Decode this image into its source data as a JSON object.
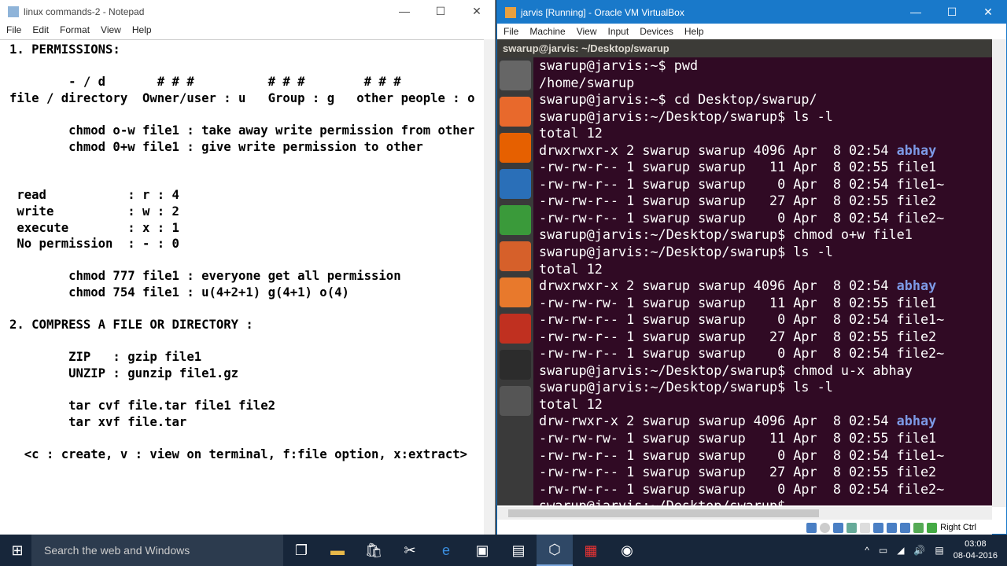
{
  "notepad": {
    "title": "linux commands-2 - Notepad",
    "menu": [
      "File",
      "Edit",
      "Format",
      "View",
      "Help"
    ],
    "lines": [
      "1. PERMISSIONS:",
      "",
      "        - / d       # # #          # # #        # # #",
      "file / directory  Owner/user : u   Group : g   other people : o",
      "",
      "        chmod o-w file1 : take away write permission from other",
      "        chmod 0+w file1 : give write permission to other",
      "",
      "",
      " read           : r : 4",
      " write          : w : 2",
      " execute        : x : 1",
      " No permission  : - : 0",
      "",
      "        chmod 777 file1 : everyone get all permission",
      "        chmod 754 file1 : u(4+2+1) g(4+1) o(4)",
      "",
      "2. COMPRESS A FILE OR DIRECTORY :",
      "",
      "        ZIP   : gzip file1",
      "        UNZIP : gunzip file1.gz",
      "",
      "        tar cvf file.tar file1 file2",
      "        tar xvf file.tar",
      "",
      "  <c : create, v : view on terminal, f:file option, x:extract>"
    ]
  },
  "virtualbox": {
    "title": "jarvis [Running] - Oracle VM VirtualBox",
    "menu": [
      "File",
      "Machine",
      "View",
      "Input",
      "Devices",
      "Help"
    ],
    "terminal_title": "swarup@jarvis: ~/Desktop/swarup",
    "host_key": "Right Ctrl",
    "lines": [
      {
        "text": "swarup@jarvis:~$ pwd"
      },
      {
        "text": "/home/swarup"
      },
      {
        "text": "swarup@jarvis:~$ cd Desktop/swarup/"
      },
      {
        "text": "swarup@jarvis:~/Desktop/swarup$ ls -l"
      },
      {
        "text": "total 12"
      },
      {
        "text": "drwxrwxr-x 2 swarup swarup 4096 Apr  8 02:54 ",
        "dir": "abhay"
      },
      {
        "text": "-rw-rw-r-- 1 swarup swarup   11 Apr  8 02:55 file1"
      },
      {
        "text": "-rw-rw-r-- 1 swarup swarup    0 Apr  8 02:54 file1~"
      },
      {
        "text": "-rw-rw-r-- 1 swarup swarup   27 Apr  8 02:55 file2"
      },
      {
        "text": "-rw-rw-r-- 1 swarup swarup    0 Apr  8 02:54 file2~"
      },
      {
        "text": "swarup@jarvis:~/Desktop/swarup$ chmod o+w file1"
      },
      {
        "text": "swarup@jarvis:~/Desktop/swarup$ ls -l"
      },
      {
        "text": "total 12"
      },
      {
        "text": "drwxrwxr-x 2 swarup swarup 4096 Apr  8 02:54 ",
        "dir": "abhay"
      },
      {
        "text": "-rw-rw-rw- 1 swarup swarup   11 Apr  8 02:55 file1"
      },
      {
        "text": "-rw-rw-r-- 1 swarup swarup    0 Apr  8 02:54 file1~"
      },
      {
        "text": "-rw-rw-r-- 1 swarup swarup   27 Apr  8 02:55 file2"
      },
      {
        "text": "-rw-rw-r-- 1 swarup swarup    0 Apr  8 02:54 file2~"
      },
      {
        "text": "swarup@jarvis:~/Desktop/swarup$ chmod u-x abhay"
      },
      {
        "text": "swarup@jarvis:~/Desktop/swarup$ ls -l"
      },
      {
        "text": "total 12"
      },
      {
        "text": "drw-rwxr-x 2 swarup swarup 4096 Apr  8 02:54 ",
        "dir": "abhay"
      },
      {
        "text": "-rw-rw-rw- 1 swarup swarup   11 Apr  8 02:55 file1"
      },
      {
        "text": "-rw-rw-r-- 1 swarup swarup    0 Apr  8 02:54 file1~"
      },
      {
        "text": "-rw-rw-r-- 1 swarup swarup   27 Apr  8 02:55 file2"
      },
      {
        "text": "-rw-rw-r-- 1 swarup swarup    0 Apr  8 02:54 file2~"
      },
      {
        "text": "swarup@jarvis:~/Desktop/swarup$ "
      }
    ],
    "launcher_icons": [
      "ubuntu-dash-icon",
      "files-icon",
      "firefox-icon",
      "writer-icon",
      "calc-icon",
      "impress-icon",
      "software-center-icon",
      "settings-icon",
      "terminal-icon",
      "workspace-icon"
    ]
  },
  "taskbar": {
    "search_placeholder": "Search the web and Windows",
    "time": "03:08",
    "date": "08-04-2016"
  },
  "colors": {
    "terminal_bg": "#300a24",
    "directory": "#7d9ae6",
    "vbox_title": "#1979ca"
  }
}
